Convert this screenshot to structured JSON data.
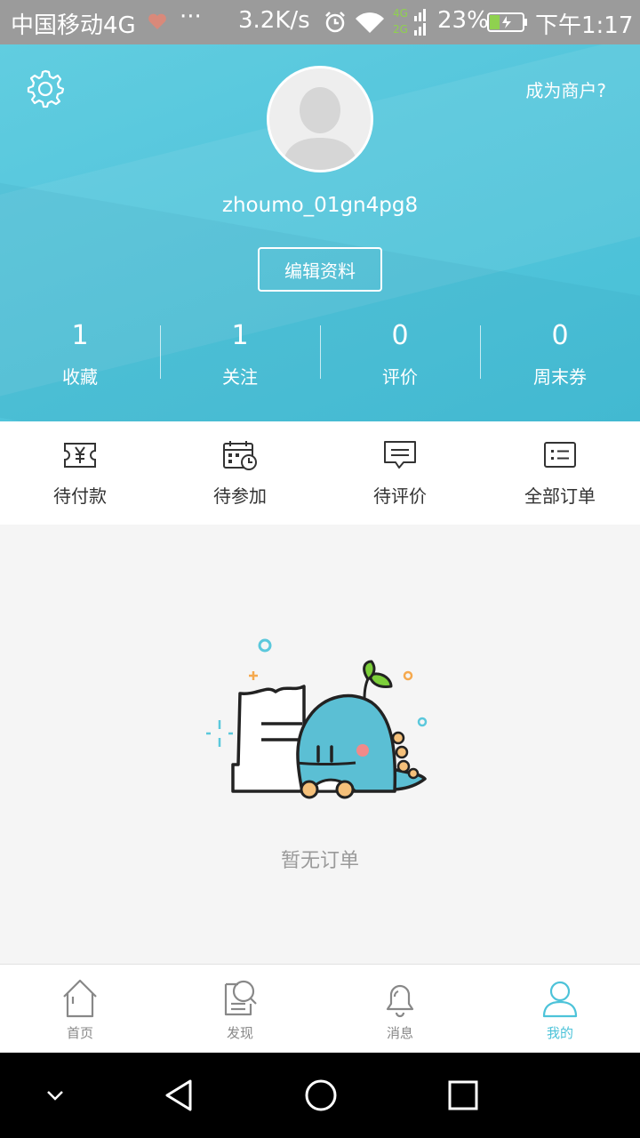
{
  "status_bar": {
    "carrier": "中国移动4G",
    "dots": "···",
    "speed": "3.2K/s",
    "battery": "23%",
    "time": "下午1:17",
    "net_top": "4G",
    "net_bottom": "2G"
  },
  "header": {
    "merchant_link": "成为商户?",
    "username": "zhoumo_01gn4pg8",
    "edit_button": "编辑资料",
    "stats": [
      {
        "value": "1",
        "label": "收藏"
      },
      {
        "value": "1",
        "label": "关注"
      },
      {
        "value": "0",
        "label": "评价"
      },
      {
        "value": "0",
        "label": "周末券"
      }
    ]
  },
  "orders": [
    {
      "label": "待付款",
      "icon": "yen-ticket-icon"
    },
    {
      "label": "待参加",
      "icon": "calendar-clock-icon"
    },
    {
      "label": "待评价",
      "icon": "comment-icon"
    },
    {
      "label": "全部订单",
      "icon": "list-icon"
    }
  ],
  "empty": {
    "text": "暂无订单"
  },
  "tabs": [
    {
      "label": "首页",
      "icon": "home-icon",
      "active": false
    },
    {
      "label": "发现",
      "icon": "discover-icon",
      "active": false
    },
    {
      "label": "消息",
      "icon": "bell-icon",
      "active": false
    },
    {
      "label": "我的",
      "icon": "user-icon",
      "active": true
    }
  ],
  "colors": {
    "accent": "#4dc3d9",
    "header": "#55c6dc"
  }
}
